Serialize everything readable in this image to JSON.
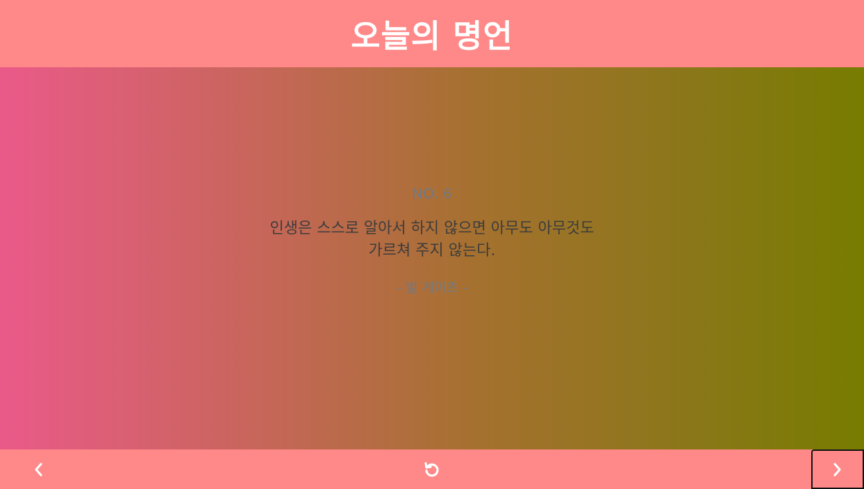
{
  "header": {
    "title": "오늘의 명언"
  },
  "quote": {
    "number": "NO. 6",
    "text": "인생은 스스로 알아서 하지 않으면 아무도 아무것도 가르쳐 주지 않는다.",
    "author": "- 빌 게이츠 -"
  },
  "footer": {
    "prev_icon": "chevron-left-icon",
    "reset_icon": "rotate-ccw-icon",
    "next_icon": "chevron-right-icon"
  },
  "colors": {
    "bar": "#ff8888",
    "gradient_start": "#ea5a89",
    "gradient_end": "#777c00",
    "title": "#ffffff",
    "quote_text": "#3c3c3c",
    "muted_text": "#6f7a86"
  }
}
